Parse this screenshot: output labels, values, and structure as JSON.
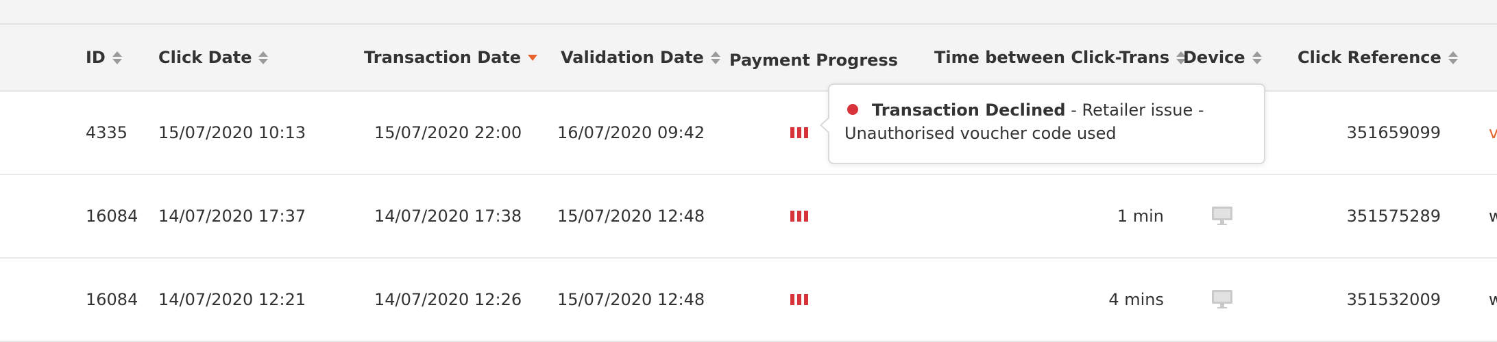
{
  "colors": {
    "accent": "#e8632b",
    "declined": "#d8333a",
    "header_bg": "#f4f4f4"
  },
  "header": {
    "id": "ID",
    "click_date": "Click Date",
    "transaction_date": "Transaction Date",
    "validation_date": "Validation Date",
    "payment_progress": "Payment Progress",
    "time_between": "Time between Click-Trans",
    "device": "Device",
    "click_reference": "Click Reference",
    "sorted_column": "Transaction Date",
    "sort_direction": "descending"
  },
  "rows": [
    {
      "id": "4335",
      "click_date": "15/07/2020 10:13",
      "transaction_date": "15/07/2020 22:00",
      "validation_date": "16/07/2020 09:42",
      "payment_status": "declined",
      "time_between": "",
      "device": "desktop-icon",
      "click_reference": "351659099",
      "trailing": "v"
    },
    {
      "id": "16084",
      "click_date": "14/07/2020 17:37",
      "transaction_date": "14/07/2020 17:38",
      "validation_date": "15/07/2020 12:48",
      "payment_status": "declined",
      "time_between": "1 min",
      "device": "desktop-icon",
      "click_reference": "351575289",
      "trailing": "w"
    },
    {
      "id": "16084",
      "click_date": "14/07/2020 12:21",
      "transaction_date": "14/07/2020 12:26",
      "validation_date": "15/07/2020 12:48",
      "payment_status": "declined",
      "time_between": "4 mins",
      "device": "desktop-icon",
      "click_reference": "351532009",
      "trailing": "w"
    }
  ],
  "tooltip": {
    "title": "Transaction Declined",
    "line1": " - Retailer issue -",
    "line2": "Unauthorised voucher code used"
  }
}
